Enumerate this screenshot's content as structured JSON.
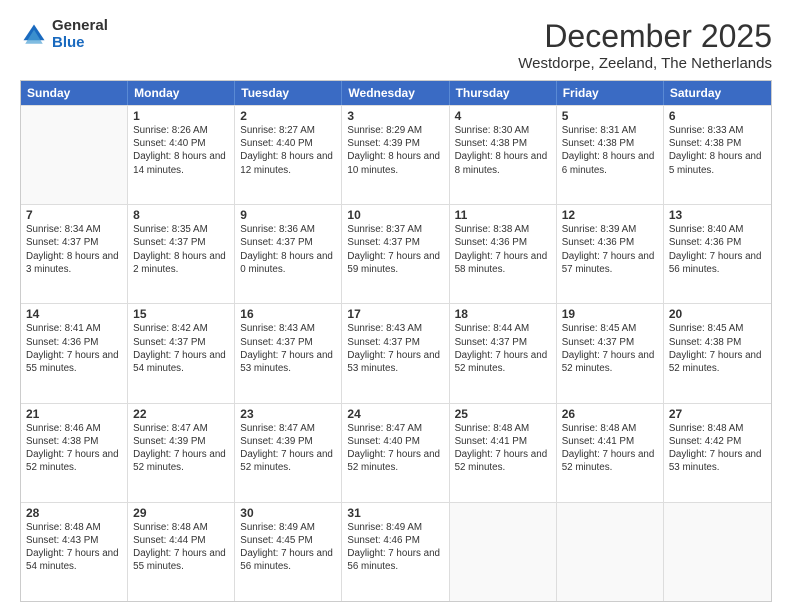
{
  "logo": {
    "general": "General",
    "blue": "Blue"
  },
  "header": {
    "month": "December 2025",
    "location": "Westdorpe, Zeeland, The Netherlands"
  },
  "days": [
    "Sunday",
    "Monday",
    "Tuesday",
    "Wednesday",
    "Thursday",
    "Friday",
    "Saturday"
  ],
  "weeks": [
    [
      {
        "day": "",
        "sunrise": "",
        "sunset": "",
        "daylight": "",
        "empty": true
      },
      {
        "day": "1",
        "sunrise": "Sunrise: 8:26 AM",
        "sunset": "Sunset: 4:40 PM",
        "daylight": "Daylight: 8 hours and 14 minutes."
      },
      {
        "day": "2",
        "sunrise": "Sunrise: 8:27 AM",
        "sunset": "Sunset: 4:40 PM",
        "daylight": "Daylight: 8 hours and 12 minutes."
      },
      {
        "day": "3",
        "sunrise": "Sunrise: 8:29 AM",
        "sunset": "Sunset: 4:39 PM",
        "daylight": "Daylight: 8 hours and 10 minutes."
      },
      {
        "day": "4",
        "sunrise": "Sunrise: 8:30 AM",
        "sunset": "Sunset: 4:38 PM",
        "daylight": "Daylight: 8 hours and 8 minutes."
      },
      {
        "day": "5",
        "sunrise": "Sunrise: 8:31 AM",
        "sunset": "Sunset: 4:38 PM",
        "daylight": "Daylight: 8 hours and 6 minutes."
      },
      {
        "day": "6",
        "sunrise": "Sunrise: 8:33 AM",
        "sunset": "Sunset: 4:38 PM",
        "daylight": "Daylight: 8 hours and 5 minutes."
      }
    ],
    [
      {
        "day": "7",
        "sunrise": "Sunrise: 8:34 AM",
        "sunset": "Sunset: 4:37 PM",
        "daylight": "Daylight: 8 hours and 3 minutes."
      },
      {
        "day": "8",
        "sunrise": "Sunrise: 8:35 AM",
        "sunset": "Sunset: 4:37 PM",
        "daylight": "Daylight: 8 hours and 2 minutes."
      },
      {
        "day": "9",
        "sunrise": "Sunrise: 8:36 AM",
        "sunset": "Sunset: 4:37 PM",
        "daylight": "Daylight: 8 hours and 0 minutes."
      },
      {
        "day": "10",
        "sunrise": "Sunrise: 8:37 AM",
        "sunset": "Sunset: 4:37 PM",
        "daylight": "Daylight: 7 hours and 59 minutes."
      },
      {
        "day": "11",
        "sunrise": "Sunrise: 8:38 AM",
        "sunset": "Sunset: 4:36 PM",
        "daylight": "Daylight: 7 hours and 58 minutes."
      },
      {
        "day": "12",
        "sunrise": "Sunrise: 8:39 AM",
        "sunset": "Sunset: 4:36 PM",
        "daylight": "Daylight: 7 hours and 57 minutes."
      },
      {
        "day": "13",
        "sunrise": "Sunrise: 8:40 AM",
        "sunset": "Sunset: 4:36 PM",
        "daylight": "Daylight: 7 hours and 56 minutes."
      }
    ],
    [
      {
        "day": "14",
        "sunrise": "Sunrise: 8:41 AM",
        "sunset": "Sunset: 4:36 PM",
        "daylight": "Daylight: 7 hours and 55 minutes."
      },
      {
        "day": "15",
        "sunrise": "Sunrise: 8:42 AM",
        "sunset": "Sunset: 4:37 PM",
        "daylight": "Daylight: 7 hours and 54 minutes."
      },
      {
        "day": "16",
        "sunrise": "Sunrise: 8:43 AM",
        "sunset": "Sunset: 4:37 PM",
        "daylight": "Daylight: 7 hours and 53 minutes."
      },
      {
        "day": "17",
        "sunrise": "Sunrise: 8:43 AM",
        "sunset": "Sunset: 4:37 PM",
        "daylight": "Daylight: 7 hours and 53 minutes."
      },
      {
        "day": "18",
        "sunrise": "Sunrise: 8:44 AM",
        "sunset": "Sunset: 4:37 PM",
        "daylight": "Daylight: 7 hours and 52 minutes."
      },
      {
        "day": "19",
        "sunrise": "Sunrise: 8:45 AM",
        "sunset": "Sunset: 4:37 PM",
        "daylight": "Daylight: 7 hours and 52 minutes."
      },
      {
        "day": "20",
        "sunrise": "Sunrise: 8:45 AM",
        "sunset": "Sunset: 4:38 PM",
        "daylight": "Daylight: 7 hours and 52 minutes."
      }
    ],
    [
      {
        "day": "21",
        "sunrise": "Sunrise: 8:46 AM",
        "sunset": "Sunset: 4:38 PM",
        "daylight": "Daylight: 7 hours and 52 minutes."
      },
      {
        "day": "22",
        "sunrise": "Sunrise: 8:47 AM",
        "sunset": "Sunset: 4:39 PM",
        "daylight": "Daylight: 7 hours and 52 minutes."
      },
      {
        "day": "23",
        "sunrise": "Sunrise: 8:47 AM",
        "sunset": "Sunset: 4:39 PM",
        "daylight": "Daylight: 7 hours and 52 minutes."
      },
      {
        "day": "24",
        "sunrise": "Sunrise: 8:47 AM",
        "sunset": "Sunset: 4:40 PM",
        "daylight": "Daylight: 7 hours and 52 minutes."
      },
      {
        "day": "25",
        "sunrise": "Sunrise: 8:48 AM",
        "sunset": "Sunset: 4:41 PM",
        "daylight": "Daylight: 7 hours and 52 minutes."
      },
      {
        "day": "26",
        "sunrise": "Sunrise: 8:48 AM",
        "sunset": "Sunset: 4:41 PM",
        "daylight": "Daylight: 7 hours and 52 minutes."
      },
      {
        "day": "27",
        "sunrise": "Sunrise: 8:48 AM",
        "sunset": "Sunset: 4:42 PM",
        "daylight": "Daylight: 7 hours and 53 minutes."
      }
    ],
    [
      {
        "day": "28",
        "sunrise": "Sunrise: 8:48 AM",
        "sunset": "Sunset: 4:43 PM",
        "daylight": "Daylight: 7 hours and 54 minutes."
      },
      {
        "day": "29",
        "sunrise": "Sunrise: 8:48 AM",
        "sunset": "Sunset: 4:44 PM",
        "daylight": "Daylight: 7 hours and 55 minutes."
      },
      {
        "day": "30",
        "sunrise": "Sunrise: 8:49 AM",
        "sunset": "Sunset: 4:45 PM",
        "daylight": "Daylight: 7 hours and 56 minutes."
      },
      {
        "day": "31",
        "sunrise": "Sunrise: 8:49 AM",
        "sunset": "Sunset: 4:46 PM",
        "daylight": "Daylight: 7 hours and 56 minutes."
      },
      {
        "day": "",
        "sunrise": "",
        "sunset": "",
        "daylight": "",
        "empty": true
      },
      {
        "day": "",
        "sunrise": "",
        "sunset": "",
        "daylight": "",
        "empty": true
      },
      {
        "day": "",
        "sunrise": "",
        "sunset": "",
        "daylight": "",
        "empty": true
      }
    ]
  ]
}
